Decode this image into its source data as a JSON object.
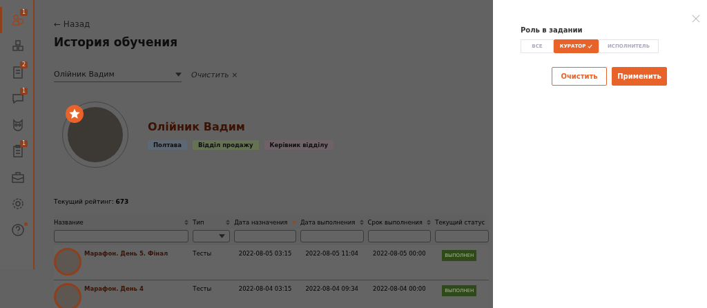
{
  "sidebar": {
    "items": [
      {
        "badge": "1",
        "selected": true,
        "dot": false
      },
      {
        "selected": false,
        "dot": false
      },
      {
        "badge": "2",
        "selected": false,
        "dot": false
      },
      {
        "badge": "1",
        "selected": false,
        "dot": false
      },
      {
        "selected": false,
        "dot": false
      },
      {
        "badge": "1",
        "selected": false,
        "dot": false
      },
      {
        "selected": false,
        "dot": false
      },
      {
        "selected": false,
        "dot": false
      },
      {
        "selected": false,
        "dot": true
      }
    ]
  },
  "back_link": "← Назад",
  "title": "История обучения",
  "employee_select": {
    "value": "Олійник Вадим"
  },
  "clear_filter": "Очистить ×",
  "profile": {
    "name": "Олійник Вадим",
    "tags": [
      {
        "label": "Полтава",
        "color": "#5e6874"
      },
      {
        "label": "Відділ продажу",
        "color": "#667254"
      },
      {
        "label": "Керівник відділу",
        "color": "#6e6268"
      }
    ]
  },
  "rating": "Текущий рейтинг: **673**",
  "table": {
    "columns": [
      {
        "label": "Название",
        "sorted": false
      },
      {
        "label": "Тип",
        "sorted": false
      },
      {
        "label": "Дата назначения",
        "sorted": true
      },
      {
        "label": "Дата выполнения",
        "sorted": false
      },
      {
        "label": "Срок выполнения",
        "sorted": false
      },
      {
        "label": "Текущий статус",
        "sorted": false
      }
    ],
    "rows": [
      {
        "name": "Марафон. День 5. Фінал",
        "type": "Тесты",
        "assigned": "2022-08-05 03:15",
        "completed": "2022-08-05 11:04",
        "deadline": "2022-08-05 00:00",
        "status": "ВЫПОЛНЕН"
      },
      {
        "name": "Марафон. День 4",
        "type": "Тесты",
        "assigned": "2022-08-04 03:15",
        "completed": "2022-08-04 09:34",
        "deadline": "2022-08-04 00:00",
        "status": "ВЫПОЛНЕН"
      }
    ]
  },
  "drawer": {
    "section_title": "Роль в задании",
    "options": [
      {
        "label": "ВСЕ",
        "selected": false
      },
      {
        "label": "КУРАТОР",
        "selected": true
      },
      {
        "label": "ИСПОЛНИТЕЛЬ",
        "selected": false
      }
    ],
    "buttons": [
      {
        "label": "Очистить",
        "kind": "outline"
      },
      {
        "label": "Применить",
        "kind": "primary"
      }
    ]
  }
}
